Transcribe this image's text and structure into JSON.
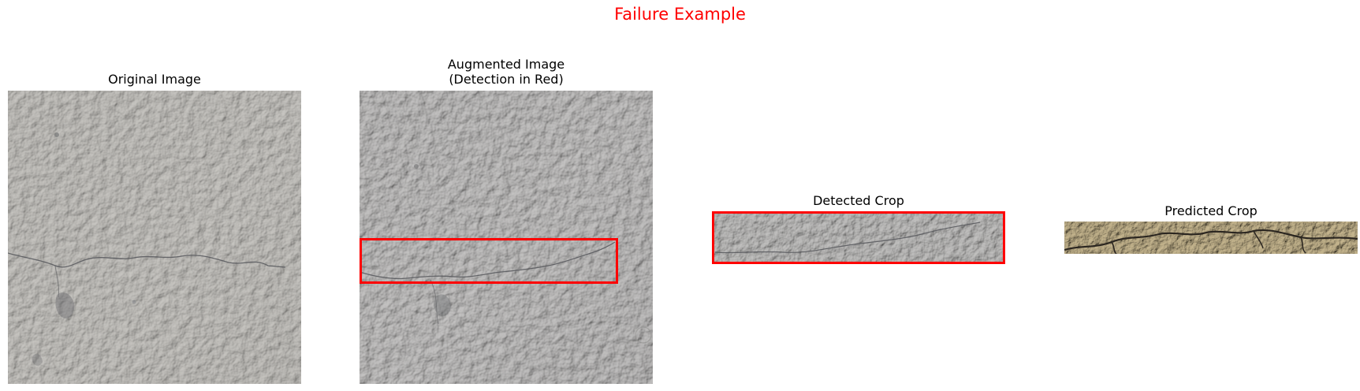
{
  "figure": {
    "suptitle": "Failure Example",
    "suptitle_color": "#ff0000",
    "detection_color": "#ff0000"
  },
  "panels": [
    {
      "title": "Original Image",
      "content": "concrete-surface-with-hairline-crack"
    },
    {
      "title_line1": "Augmented Image",
      "title_line2": "(Detection in Red)",
      "content": "augmented-concrete-surface-with-detection-box"
    },
    {
      "title": "Detected Crop",
      "content": "crop-of-detected-crack-region"
    },
    {
      "title": "Predicted Crop",
      "content": "crop-of-rough-cracked-concrete"
    }
  ]
}
